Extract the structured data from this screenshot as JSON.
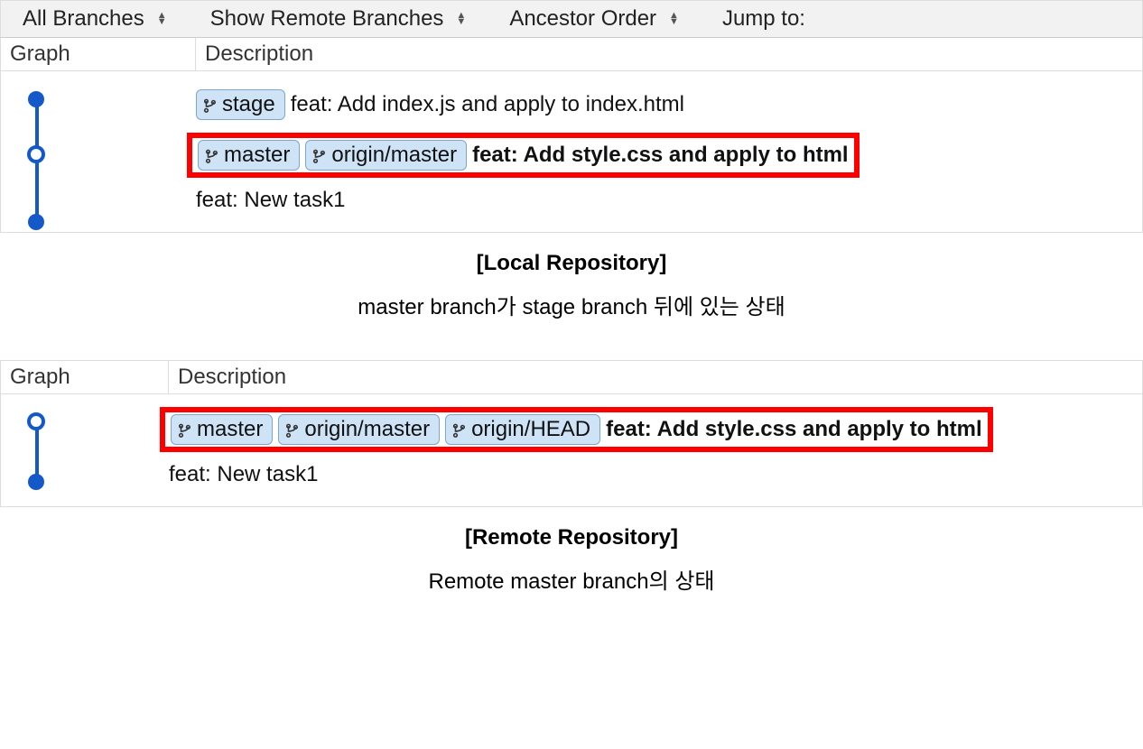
{
  "toolbar": {
    "all_branches": "All Branches",
    "show_remote": "Show Remote Branches",
    "ancestor_order": "Ancestor Order",
    "jump_to": "Jump to:"
  },
  "columns": {
    "graph": "Graph",
    "description": "Description"
  },
  "local_commits": [
    {
      "branches": [
        "stage"
      ],
      "message": "feat: Add index.js and apply to index.html",
      "bold": false
    },
    {
      "branches": [
        "master",
        "origin/master"
      ],
      "message": "feat: Add style.css and apply to html",
      "bold": true,
      "highlighted": true
    },
    {
      "branches": [],
      "message": "feat: New task1",
      "bold": false
    }
  ],
  "remote_commits": [
    {
      "branches": [
        "master",
        "origin/master",
        "origin/HEAD"
      ],
      "message": "feat: Add style.css and apply to html",
      "bold": true,
      "highlighted": true
    },
    {
      "branches": [],
      "message": "feat: New task1",
      "bold": false
    }
  ],
  "captions": {
    "local_title": "[Local Repository]",
    "local_sub": "master branch가 stage branch 뒤에 있는 상태",
    "remote_title": "[Remote Repository]",
    "remote_sub": "Remote master branch의 상태"
  }
}
